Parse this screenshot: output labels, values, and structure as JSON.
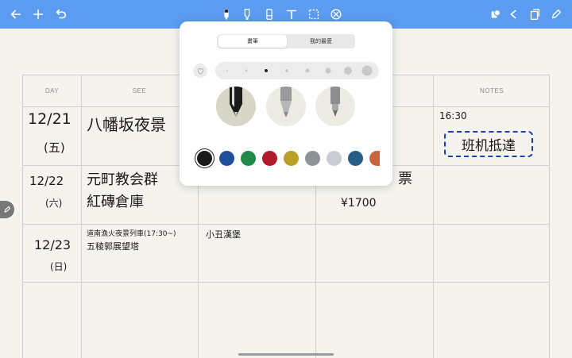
{
  "toolbar": {
    "left_icons": [
      "back-arrow-icon",
      "plus-icon",
      "undo-icon"
    ],
    "center_tools": [
      "pen-tool-icon",
      "highlighter-tool-icon",
      "eraser-tool-icon",
      "text-tool-icon",
      "lasso-tool-icon",
      "shape-tool-icon"
    ],
    "right_icons": [
      "shapes-icon",
      "share-icon",
      "pages-icon",
      "edit-icon"
    ],
    "colors": {
      "bar": "#5b9bf0",
      "icon": "#ffffff"
    }
  },
  "table": {
    "headers": [
      "DAY",
      "SEE",
      "",
      "",
      "NOTES"
    ],
    "rows": [
      {
        "day": "12/21",
        "weekday": "(五)",
        "see": "八幡坂夜景",
        "eat": "",
        "extra": "",
        "notes_time": "16:30",
        "notes_box": "班机抵達"
      },
      {
        "day": "12/22",
        "weekday": "(六)",
        "see": [
          "元町教会群",
          "紅磚倉庫"
        ],
        "eat": "",
        "extra_fragment": "票",
        "price": "¥1700",
        "notes_time": "",
        "notes_box": ""
      },
      {
        "day": "12/23",
        "weekday": "(日)",
        "see": [
          "道南漁火夜景列車(17:30~)",
          "五稜郭展望塔"
        ],
        "eat": "小丑漢堡",
        "extra": ""
      }
    ]
  },
  "popup": {
    "tabs": {
      "active": "畫筆",
      "other": "我的最愛"
    },
    "pens": [
      "ballpoint-pen",
      "fountain-pen",
      "brush-pen"
    ],
    "selected_pen": "ballpoint-pen",
    "swatches": [
      "#1a1a1a",
      "#1f4f9a",
      "#1f8a4a",
      "#b31b2a",
      "#b8a124",
      "#8d9299",
      "#c9ccd0",
      "#2a5d86",
      "#c9653e"
    ],
    "selected_swatch": "#1a1a1a"
  }
}
